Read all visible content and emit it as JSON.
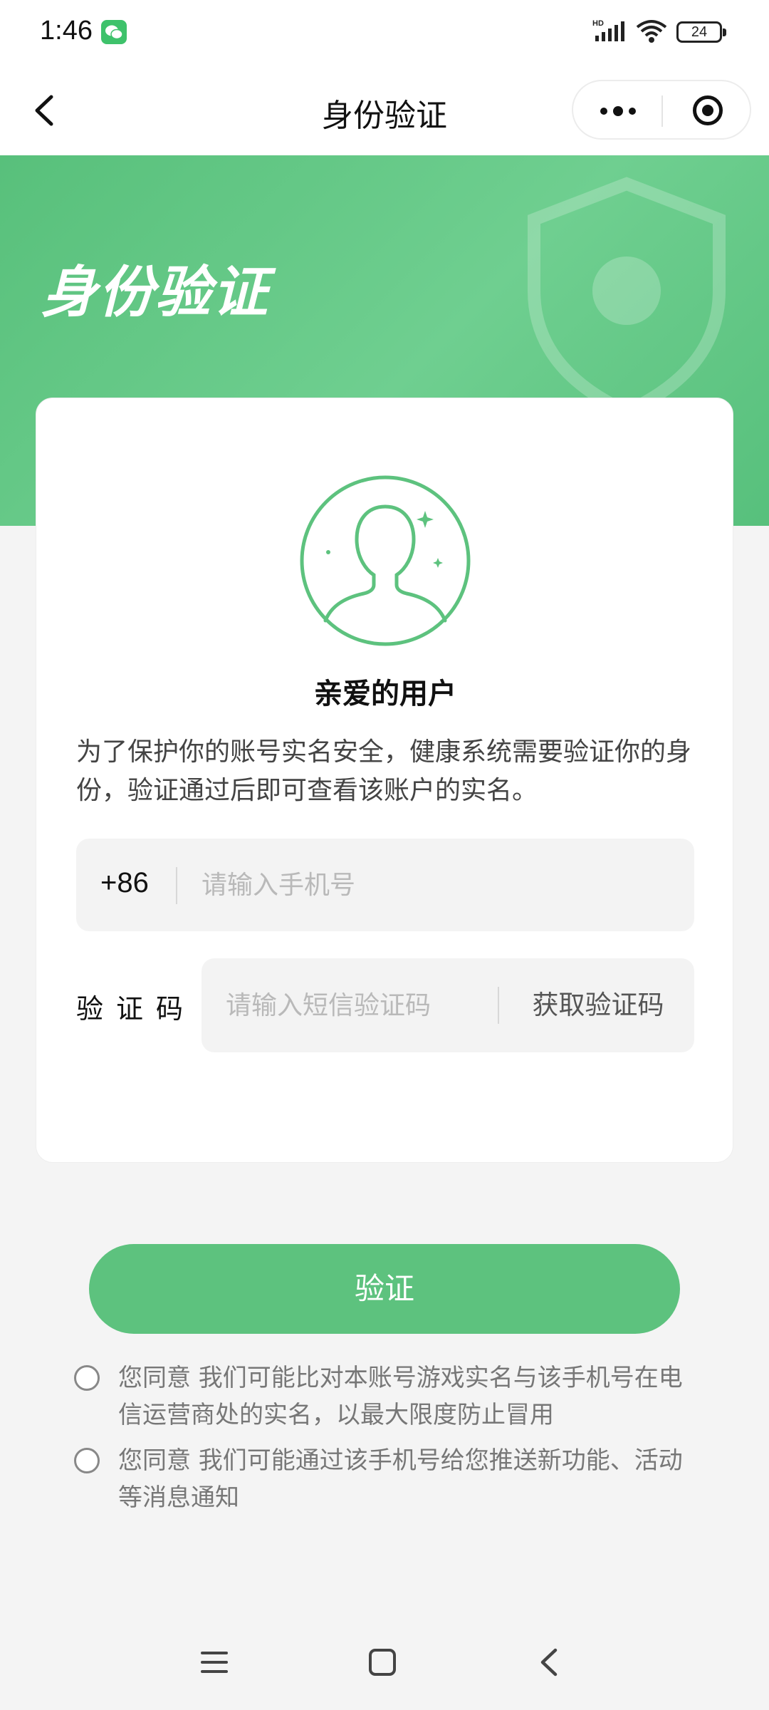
{
  "status_bar": {
    "time": "1:46",
    "network": "HD",
    "battery": "24"
  },
  "nav": {
    "title": "身份验证"
  },
  "hero": {
    "title": "身份验证"
  },
  "card": {
    "greeting": "亲爱的用户",
    "description": "为了保护你的账号实名安全，健康系统需要验证你的身份，验证通过后即可查看该账户的实名。",
    "phone": {
      "country_code": "+86",
      "placeholder": "请输入手机号",
      "value": ""
    },
    "code": {
      "label": "验证码",
      "placeholder": "请输入短信验证码",
      "value": "",
      "get_code_label": "获取验证码"
    }
  },
  "verify_button": "验证",
  "agreements": [
    {
      "text": "您同意 我们可能比对本账号游戏实名与该手机号在电信运营商处的实名，以最大限度防止冒用",
      "checked": false
    },
    {
      "text": "您同意 我们可能通过该手机号给您推送新功能、活动等消息通知",
      "checked": false
    }
  ],
  "colors": {
    "brand_green": "#5dc27e",
    "hero_green": "#58c07b",
    "background": "#f4f4f4"
  }
}
